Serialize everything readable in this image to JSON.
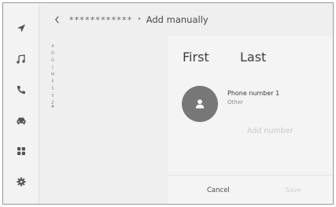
{
  "nav": {
    "items": [
      {
        "icon": "navigation-arrow-icon"
      },
      {
        "icon": "music-note-icon"
      },
      {
        "icon": "phone-icon"
      },
      {
        "icon": "car-icon"
      },
      {
        "icon": "apps-grid-icon"
      },
      {
        "icon": "settings-gear-icon"
      }
    ]
  },
  "header": {
    "back_icon": "chevron-left-icon",
    "masked_name": "************",
    "separator": "•",
    "title": "Add manually"
  },
  "index": [
    "A",
    "·",
    "D",
    "·",
    "G",
    "·",
    "J",
    "·",
    "M",
    "·",
    "P",
    "·",
    "S",
    "·",
    "V",
    "·",
    "Z",
    "#"
  ],
  "contact": {
    "first_name": "First",
    "last_name": "Last",
    "avatar_icon": "person-icon",
    "phone_label": "Phone number 1",
    "phone_type": "Other",
    "add_number": "Add number"
  },
  "actions": {
    "cancel": "Cancel",
    "save": "Save"
  },
  "colors": {
    "avatar": "#777777",
    "disabled_text": "#cfcfcf"
  }
}
